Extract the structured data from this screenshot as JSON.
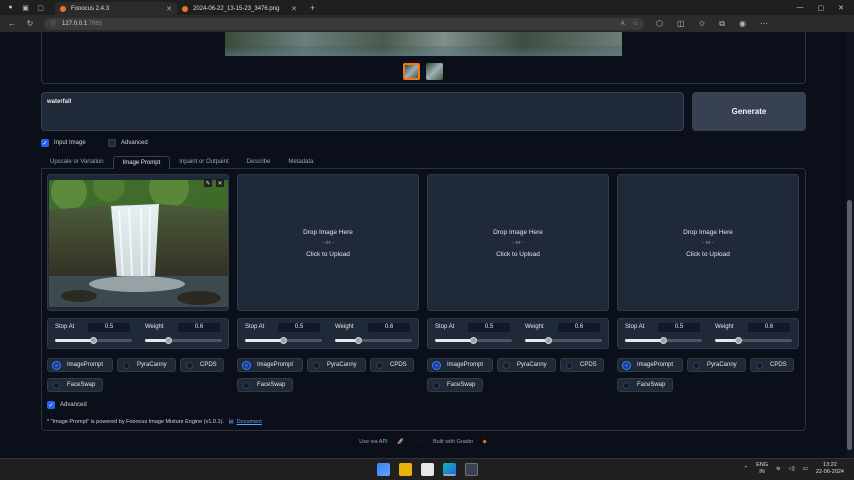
{
  "browser": {
    "tabs": [
      {
        "title": "Fooocus 2.4.3",
        "active": true
      },
      {
        "title": "2024-06-22_13-15-23_3476.png",
        "active": false
      }
    ],
    "url_host": "127.0.0.1",
    "url_port": ":7865"
  },
  "prompt": {
    "value": "waterfall"
  },
  "generate_label": "Generate",
  "options": {
    "input_image_label": "Input Image",
    "input_image_checked": true,
    "advanced_label": "Advanced",
    "advanced_checked": false
  },
  "tabs": [
    "Upscale or Variation",
    "Image Prompt",
    "Inpaint or Outpaint",
    "Describe",
    "Metadata"
  ],
  "active_tab": "Image Prompt",
  "upload": {
    "drop": "Drop Image Here",
    "or": "- or -",
    "click": "Click to Upload"
  },
  "slots": [
    {
      "has_image": true,
      "stop_at_label": "Stop At",
      "stop_at": "0.5",
      "weight_label": "Weight",
      "weight": "0.6",
      "types": [
        "ImagePrompt",
        "PyraCanny",
        "CPDS",
        "FaceSwap"
      ],
      "selected": "ImagePrompt"
    },
    {
      "has_image": false,
      "stop_at_label": "Stop At",
      "stop_at": "0.5",
      "weight_label": "Weight",
      "weight": "0.6",
      "types": [
        "ImagePrompt",
        "PyraCanny",
        "CPDS",
        "FaceSwap"
      ],
      "selected": "ImagePrompt"
    },
    {
      "has_image": false,
      "stop_at_label": "Stop At",
      "stop_at": "0.5",
      "weight_label": "Weight",
      "weight": "0.6",
      "types": [
        "ImagePrompt",
        "PyraCanny",
        "CPDS",
        "FaceSwap"
      ],
      "selected": "ImagePrompt"
    },
    {
      "has_image": false,
      "stop_at_label": "Stop At",
      "stop_at": "0.5",
      "weight_label": "Weight",
      "weight": "0.6",
      "types": [
        "ImagePrompt",
        "PyraCanny",
        "CPDS",
        "FaceSwap"
      ],
      "selected": "ImagePrompt"
    }
  ],
  "advanced2": {
    "label": "Advanced",
    "checked": true
  },
  "note": {
    "text": "* \"Image Prompt\" is powered by Fooocus Image Mixture Engine (v1.0.1).",
    "link": "Document"
  },
  "footer": {
    "api": "Use via API",
    "built": "Built with Gradio"
  },
  "taskbar": {
    "lang_top": "ENG",
    "lang_bottom": "IN",
    "time": "13:22",
    "date": "22-06-2024"
  },
  "colors": {
    "accent": "#2563eb",
    "panel": "#1f2937",
    "background": "#0b0f19",
    "selected_thumb": "#f97316"
  }
}
